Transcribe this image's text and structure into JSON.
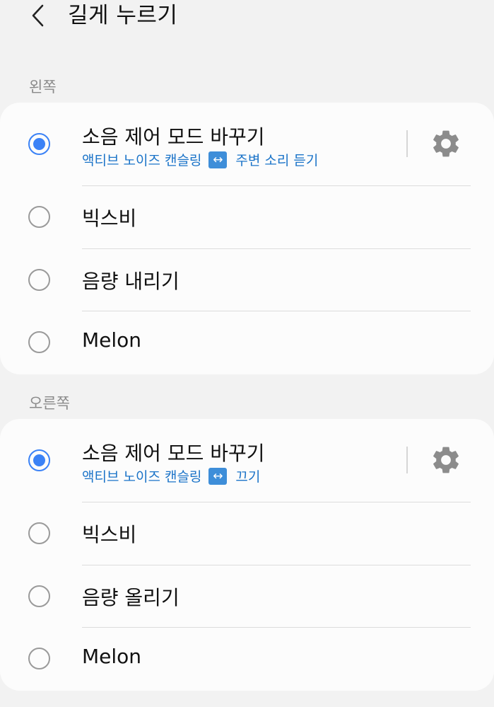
{
  "header": {
    "title": "길게 누르기"
  },
  "left": {
    "label": "왼쪽",
    "items": [
      {
        "title": "소음 제어 모드 바꾸기",
        "subtitle_from": "액티브 노이즈 캔슬링",
        "swap_icon": "↔",
        "subtitle_to": "주변 소리 듣기",
        "selected": true
      },
      {
        "title": "빅스비",
        "selected": false
      },
      {
        "title": "음량 내리기",
        "selected": false
      },
      {
        "title": "Melon",
        "selected": false
      }
    ]
  },
  "right": {
    "label": "오른쪽",
    "items": [
      {
        "title": "소음 제어 모드 바꾸기",
        "subtitle_from": "액티브 노이즈 캔슬링",
        "swap_icon": "↔",
        "subtitle_to": "끄기",
        "selected": true
      },
      {
        "title": "빅스비",
        "selected": false
      },
      {
        "title": "음량 올리기",
        "selected": false
      },
      {
        "title": "Melon",
        "selected": false
      }
    ]
  },
  "colors": {
    "accent": "#3b82f6",
    "subtitle": "#1a73c8",
    "background": "#f2f2f2",
    "card": "#fcfcfc"
  },
  "icons": {
    "back": "back-arrow-icon",
    "settings": "gear-icon"
  }
}
